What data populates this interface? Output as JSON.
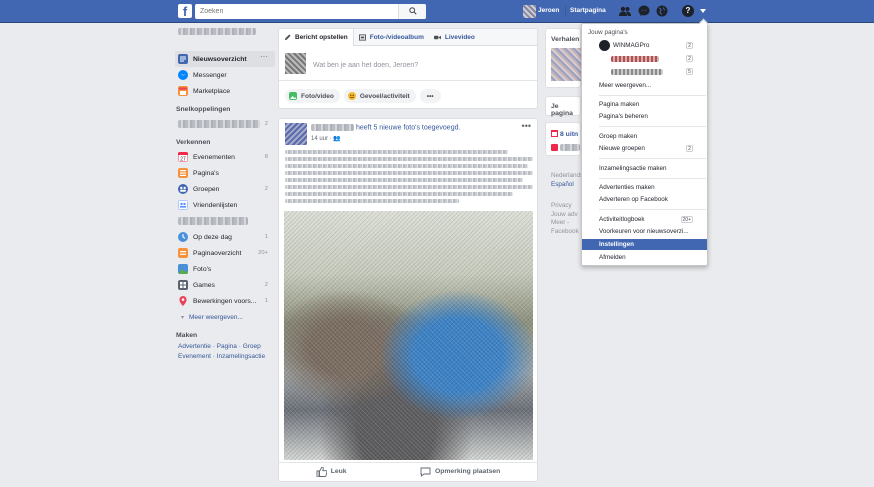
{
  "header": {
    "logo": "f",
    "search_placeholder": "Zoeken",
    "profile_name": "Jeroen",
    "home_label": "Startpagina"
  },
  "sidebar": {
    "main": [
      {
        "label": "Nieuwsoverzicht",
        "icon": "news-feed-icon",
        "color": "#4267b2"
      },
      {
        "label": "Messenger",
        "icon": "messenger-icon",
        "color": "#0084ff"
      },
      {
        "label": "Marketplace",
        "icon": "marketplace-icon",
        "color": "#f7923b"
      }
    ],
    "shortcuts_heading": "Snelkoppelingen",
    "shortcuts_count": "2",
    "explore_heading": "Verkennen",
    "explore": [
      {
        "label": "Evenementen",
        "count": "8",
        "icon": "calendar-icon",
        "color": "#f02849"
      },
      {
        "label": "Pagina's",
        "count": "",
        "icon": "flag-icon",
        "color": "#f7923b"
      },
      {
        "label": "Groepen",
        "count": "2",
        "icon": "groups-icon",
        "color": "#4267b2"
      },
      {
        "label": "Vriendenlijsten",
        "count": "",
        "icon": "friend-list-icon",
        "color": "#5890ff"
      }
    ],
    "explore2": [
      {
        "label": "Op deze dag",
        "count": "1",
        "icon": "memories-icon",
        "color": "#4a90d9"
      },
      {
        "label": "Paginaoverzicht",
        "count": "20+",
        "icon": "page-feed-icon",
        "color": "#f7923b"
      },
      {
        "label": "Foto's",
        "count": "",
        "icon": "photos-icon",
        "color": "#5bab4b"
      },
      {
        "label": "Games",
        "count": "2",
        "icon": "games-icon",
        "color": "#59626f"
      },
      {
        "label": "Bewerkingen voors...",
        "count": "1",
        "icon": "location-pin-icon",
        "color": "#e9425a"
      }
    ],
    "more": "Meer weergeven...",
    "create_heading": "Maken",
    "create_links": [
      "Advertentie",
      "Pagina",
      "Groep",
      "Evenement",
      "Inzamelingsactie"
    ]
  },
  "composer": {
    "tabs": [
      "Bericht opstellen",
      "Foto-/videoalbum",
      "Livevideo"
    ],
    "placeholder": "Wat ben je aan het doen, Jeroen?",
    "actions": [
      "Foto/video",
      "Gevoel/activiteit",
      "•••"
    ]
  },
  "post": {
    "action": "heeft 5 nieuwe foto's toegevoegd.",
    "time": "14 uur",
    "more": "•••",
    "like": "Leuk",
    "comment": "Opmerking plaatsen"
  },
  "right": {
    "stories_title": "Verhalen",
    "pages_title": "Je pagina",
    "events_count": "8 uitn",
    "languages": [
      "Nederlands",
      "Español"
    ],
    "footer": [
      "Privacy",
      "Jouw adv",
      "Meer -",
      "Facebook"
    ]
  },
  "menu": {
    "title": "Jouw pagina's",
    "pages": [
      {
        "name": "WINMAGPro",
        "count": "2"
      },
      {
        "name": "",
        "count": "2"
      },
      {
        "name": "",
        "count": "5"
      }
    ],
    "more": "Meer weergeven...",
    "items": [
      {
        "label": "Pagina maken",
        "badge": ""
      },
      {
        "label": "Pagina's beheren",
        "badge": ""
      },
      {
        "label": "Groep maken",
        "badge": ""
      },
      {
        "label": "Nieuwe groepen",
        "badge": "2"
      },
      {
        "label": "Inzamelingsactie maken",
        "badge": ""
      },
      {
        "label": "Advertenties maken",
        "badge": ""
      },
      {
        "label": "Adverteren op Facebook",
        "badge": ""
      },
      {
        "label": "Activiteitlogboek",
        "badge": "20+"
      },
      {
        "label": "Voorkeuren voor nieuwsoverzi...",
        "badge": ""
      },
      {
        "label": "Instellingen",
        "badge": ""
      },
      {
        "label": "Afmelden",
        "badge": ""
      }
    ]
  }
}
